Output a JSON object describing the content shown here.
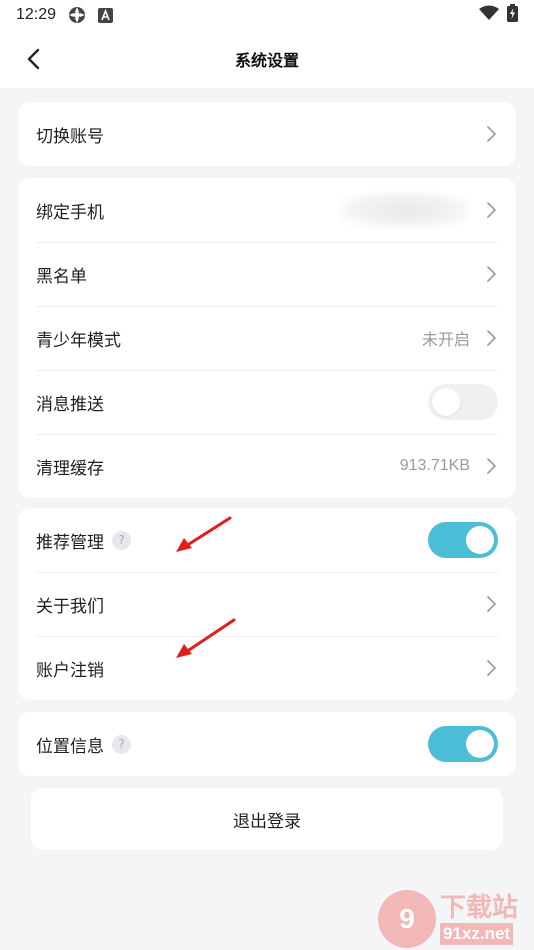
{
  "status_bar": {
    "time": "12:29",
    "icons": [
      "sync-status-icon",
      "a-notification-icon",
      "wifi-icon",
      "battery-icon"
    ]
  },
  "header": {
    "title": "系统设置",
    "back_icon": "chevron-left-icon"
  },
  "sections": {
    "account": {
      "switch_account": "切换账号"
    },
    "general": {
      "bind_phone": "绑定手机",
      "blacklist": "黑名单",
      "teen_mode": "青少年模式",
      "teen_mode_value": "未开启",
      "push": "消息推送",
      "push_enabled": false,
      "clear_cache": "清理缓存",
      "cache_size": "913.71KB"
    },
    "manage": {
      "recommend": "推荐管理",
      "recommend_enabled": true,
      "about": "关于我们",
      "delete_account": "账户注销"
    },
    "location": {
      "label": "位置信息",
      "enabled": true
    }
  },
  "help_symbol": "?",
  "logout_label": "退出登录",
  "watermark": {
    "logo": "9",
    "main": "下载站",
    "sub": "91xz.net"
  },
  "colors": {
    "toggle_on": "#4bbdd6",
    "toggle_off": "#f0f0f2",
    "annotation_arrow": "#e11d1d",
    "background": "#f4f5f7"
  }
}
